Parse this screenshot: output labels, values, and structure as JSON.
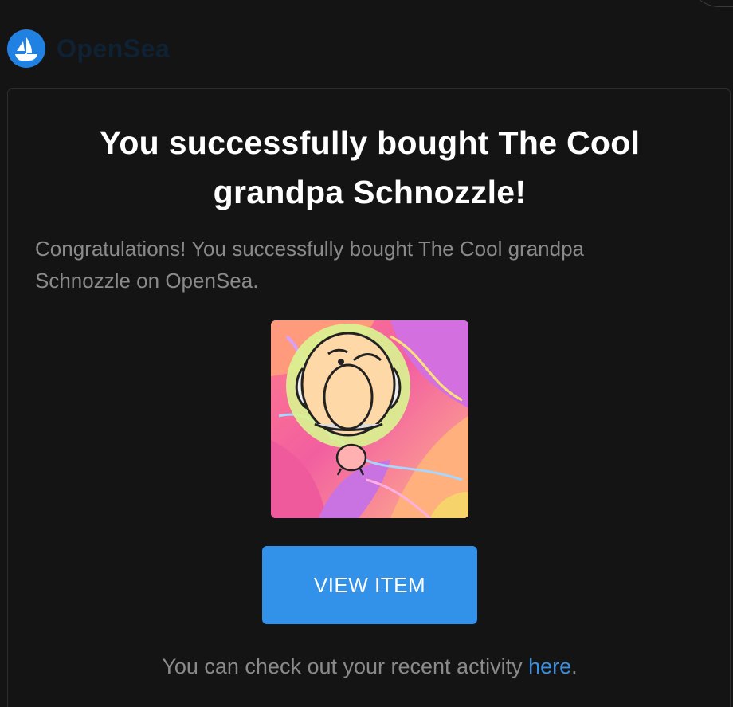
{
  "brand": {
    "name": "OpenSea",
    "logo_icon": "opensea-boat-icon",
    "accent_color": "#2081e2"
  },
  "email": {
    "title_line1": "You successfully bought The Cool",
    "title_line2": "grandpa Schnozzle!",
    "message_line1": "Congratulations! You successfully bought The Cool grandpa",
    "message_line2": "Schnozzle on OpenSea.",
    "nft_image_label": "The Cool grandpa Schnozzle",
    "view_button_label": "VIEW ITEM",
    "button_color": "#3291e9",
    "footer_prefix": "You can check out your recent activity ",
    "footer_link": "here",
    "footer_suffix": "."
  }
}
